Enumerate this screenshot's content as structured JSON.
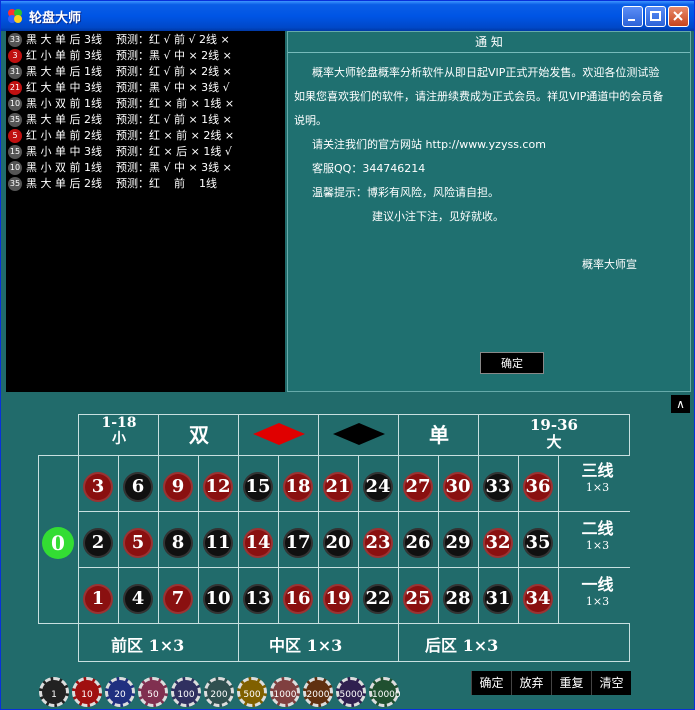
{
  "window": {
    "title": "轮盘大师"
  },
  "log": [
    {
      "n": "33",
      "c": "#555",
      "t": "黑 大 单 后 3线    预测：红 √ 前 √ 2线 ×"
    },
    {
      "n": "3",
      "c": "#c01010",
      "t": "红 小 单 前 3线    预测：黑 √ 中 × 2线 ×"
    },
    {
      "n": "31",
      "c": "#555",
      "t": "黑 大 单 后 1线    预测：红 √ 前 × 2线 ×"
    },
    {
      "n": "21",
      "c": "#c01010",
      "t": "红 大 单 中 3线    预测：黑 √ 中 × 3线 √"
    },
    {
      "n": "10",
      "c": "#555",
      "t": "黑 小 双 前 1线    预测：红 × 前 × 1线 ×"
    },
    {
      "n": "35",
      "c": "#555",
      "t": "黑 大 单 后 2线    预测：红 √ 前 × 1线 ×"
    },
    {
      "n": "5",
      "c": "#c01010",
      "t": "红 小 单 前 2线    预测：红 × 前 × 2线 ×"
    },
    {
      "n": "15",
      "c": "#555",
      "t": "黑 小 单 中 3线    预测：红 × 后 × 1线 √"
    },
    {
      "n": "10",
      "c": "#555",
      "t": "黑 小 双 前 1线    预测：黑 √ 中 × 3线 ×"
    },
    {
      "n": "35",
      "c": "#555",
      "t": "黑 大 单 后 2线    预测：红    前    1线"
    }
  ],
  "notice": {
    "title": "通  知",
    "p1": "概率大师轮盘概率分析软件从即日起VIP正式开始发售。欢迎各位测试验",
    "p2": "如果您喜欢我们的软件，请注册续费成为正式会员。祥见VIP通道中的会员备",
    "p3": "说明。",
    "site_label": "请关注我们的官方网站  http://www.yzyss.com",
    "qq": "客服QQ：344746214",
    "tip": "温馨提示：博彩有风险，风险请自担。",
    "tip2": "建议小注下注，见好就收。",
    "sign": "概率大师宣",
    "ok": "确定"
  },
  "collapse": "∧",
  "headers": {
    "small_num": "1-18",
    "small": "小",
    "even": "双",
    "odd": "单",
    "big_num": "19-36",
    "big": "大"
  },
  "lines": [
    {
      "name": "三线",
      "mult": "1×3"
    },
    {
      "name": "二线",
      "mult": "1×3"
    },
    {
      "name": "一线",
      "mult": "1×3"
    }
  ],
  "zero": "0",
  "rows": [
    [
      [
        "3",
        "red"
      ],
      [
        "6",
        "black"
      ],
      [
        "9",
        "red"
      ],
      [
        "12",
        "red"
      ],
      [
        "15",
        "black"
      ],
      [
        "18",
        "red"
      ],
      [
        "21",
        "red"
      ],
      [
        "24",
        "black"
      ],
      [
        "27",
        "red"
      ],
      [
        "30",
        "red"
      ],
      [
        "33",
        "black"
      ],
      [
        "36",
        "red"
      ]
    ],
    [
      [
        "2",
        "black"
      ],
      [
        "5",
        "red"
      ],
      [
        "8",
        "black"
      ],
      [
        "11",
        "black"
      ],
      [
        "14",
        "red"
      ],
      [
        "17",
        "black"
      ],
      [
        "20",
        "black"
      ],
      [
        "23",
        "red"
      ],
      [
        "26",
        "black"
      ],
      [
        "29",
        "black"
      ],
      [
        "32",
        "red"
      ],
      [
        "35",
        "black"
      ]
    ],
    [
      [
        "1",
        "red"
      ],
      [
        "4",
        "black"
      ],
      [
        "7",
        "red"
      ],
      [
        "10",
        "black"
      ],
      [
        "13",
        "black"
      ],
      [
        "16",
        "red"
      ],
      [
        "19",
        "red"
      ],
      [
        "22",
        "black"
      ],
      [
        "25",
        "red"
      ],
      [
        "28",
        "black"
      ],
      [
        "31",
        "black"
      ],
      [
        "34",
        "red"
      ]
    ]
  ],
  "zones": [
    "前区  1×3",
    "中区  1×3",
    "后区  1×3"
  ],
  "chips": [
    {
      "v": "1",
      "c": "#222"
    },
    {
      "v": "10",
      "c": "#a01010"
    },
    {
      "v": "20",
      "c": "#203080"
    },
    {
      "v": "50",
      "c": "#803050"
    },
    {
      "v": "100",
      "c": "#303060"
    },
    {
      "v": "200",
      "c": "#305050"
    },
    {
      "v": "500",
      "c": "#806000"
    },
    {
      "v": "1000",
      "c": "#804040"
    },
    {
      "v": "2000",
      "c": "#603010"
    },
    {
      "v": "5000",
      "c": "#302050"
    },
    {
      "v": "10000",
      "c": "#205030"
    }
  ],
  "actions": [
    "确定",
    "放弃",
    "重复",
    "清空"
  ]
}
